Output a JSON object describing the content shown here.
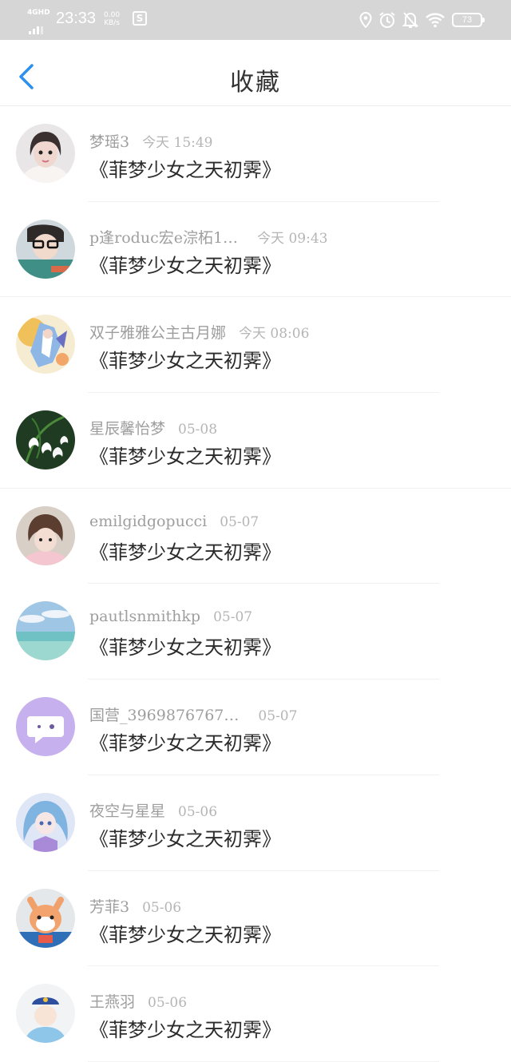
{
  "status_bar": {
    "network": "4GHD",
    "time": "23:33",
    "speed_value": "0.00",
    "speed_unit": "KB/s",
    "app_icon_letter": "S",
    "battery": "73",
    "icons": [
      "location-icon",
      "alarm-icon",
      "mute-bell-icon",
      "wifi-icon",
      "battery-icon"
    ]
  },
  "header": {
    "title": "收藏",
    "back_icon": "chevron-left-icon",
    "accent_color": "#2d8ff0"
  },
  "favorites": [
    {
      "name": "梦瑶3",
      "time": "今天 15:49",
      "work": "《菲梦少女之天初霁》",
      "avatar": "girl-portrait"
    },
    {
      "name": "p逢roduc宏e淙柘1…",
      "time": "今天 09:43",
      "work": "《菲梦少女之天初霁》",
      "avatar": "boy-glasses"
    },
    {
      "name": "双子雅雅公主古月娜",
      "time": "今天 08:06",
      "work": "《菲梦少女之天初霁》",
      "avatar": "anime-art"
    },
    {
      "name": "星辰馨怡梦",
      "time": "05-08",
      "work": "《菲梦少女之天初霁》",
      "avatar": "white-flowers"
    },
    {
      "name": "emilgidgopucci",
      "time": "05-07",
      "work": "《菲梦少女之天初霁》",
      "avatar": "child-photo"
    },
    {
      "name": "pautlsnmithkp",
      "time": "05-07",
      "work": "《菲梦少女之天初霁》",
      "avatar": "beach-sky"
    },
    {
      "name": "国营_3969876767…",
      "time": "05-07",
      "work": "《菲梦少女之天初霁》",
      "avatar": "purple-chat-bubble"
    },
    {
      "name": "夜空与星星",
      "time": "05-06",
      "work": "《菲梦少女之天初霁》",
      "avatar": "anime-girl-blue-hair"
    },
    {
      "name": "芳菲3",
      "time": "05-06",
      "work": "《菲梦少女之天初霁》",
      "avatar": "cartoon-fox"
    },
    {
      "name": "王燕羽",
      "time": "05-06",
      "work": "《菲梦少女之天初霁》",
      "avatar": "cartoon-blue"
    }
  ]
}
